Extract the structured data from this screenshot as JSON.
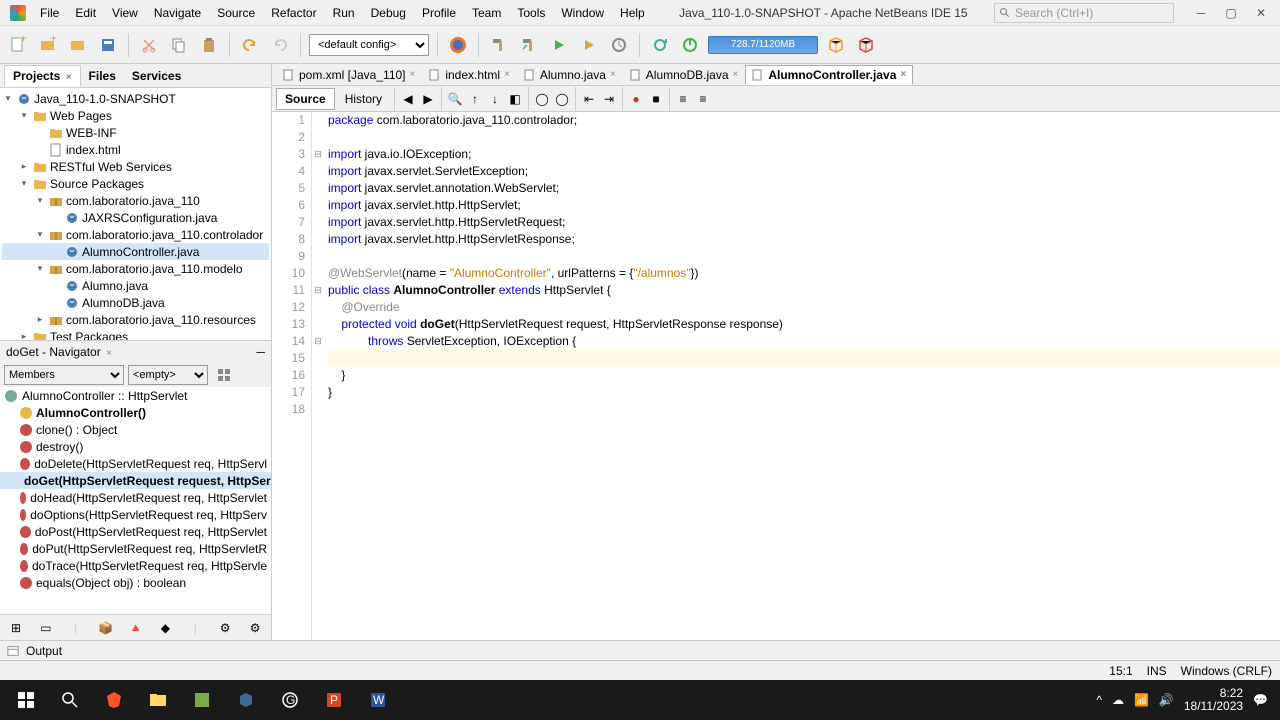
{
  "window_title": "Java_110-1.0-SNAPSHOT - Apache NetBeans IDE 15",
  "search_placeholder": "Search (Ctrl+I)",
  "menu": [
    "File",
    "Edit",
    "View",
    "Navigate",
    "Source",
    "Refactor",
    "Run",
    "Debug",
    "Profile",
    "Team",
    "Tools",
    "Window",
    "Help"
  ],
  "config_select": "<default config>",
  "memory": "728.7/1120MB",
  "left_tabs": [
    "Projects",
    "Files",
    "Services"
  ],
  "project_tree": [
    {
      "indent": 0,
      "toggle": "▾",
      "icon": "java",
      "label": "Java_110-1.0-SNAPSHOT"
    },
    {
      "indent": 1,
      "toggle": "▾",
      "icon": "folder",
      "label": "Web Pages"
    },
    {
      "indent": 2,
      "toggle": "",
      "icon": "folder",
      "label": "WEB-INF"
    },
    {
      "indent": 2,
      "toggle": "",
      "icon": "page",
      "label": "index.html"
    },
    {
      "indent": 1,
      "toggle": "▸",
      "icon": "folder",
      "label": "RESTful Web Services"
    },
    {
      "indent": 1,
      "toggle": "▾",
      "icon": "folder",
      "label": "Source Packages"
    },
    {
      "indent": 2,
      "toggle": "▾",
      "icon": "pkg",
      "label": "com.laboratorio.java_110"
    },
    {
      "indent": 3,
      "toggle": "",
      "icon": "java",
      "label": "JAXRSConfiguration.java"
    },
    {
      "indent": 2,
      "toggle": "▾",
      "icon": "pkg",
      "label": "com.laboratorio.java_110.controlador"
    },
    {
      "indent": 3,
      "toggle": "",
      "icon": "java",
      "label": "AlumnoController.java",
      "selected": true
    },
    {
      "indent": 2,
      "toggle": "▾",
      "icon": "pkg",
      "label": "com.laboratorio.java_110.modelo"
    },
    {
      "indent": 3,
      "toggle": "",
      "icon": "java",
      "label": "Alumno.java"
    },
    {
      "indent": 3,
      "toggle": "",
      "icon": "java",
      "label": "AlumnoDB.java"
    },
    {
      "indent": 2,
      "toggle": "▸",
      "icon": "pkg",
      "label": "com.laboratorio.java_110.resources"
    },
    {
      "indent": 1,
      "toggle": "▸",
      "icon": "folder",
      "label": "Test Packages"
    }
  ],
  "navigator": {
    "title": "doGet - Navigator",
    "filter_label": "Members",
    "empty_label": "<empty>",
    "class_label": "AlumnoController :: HttpServlet",
    "items": [
      {
        "color": "#e8b64a",
        "label": "AlumnoController()",
        "bold": true
      },
      {
        "color": "#c6504f",
        "label": "clone() : Object"
      },
      {
        "color": "#c6504f",
        "label": "destroy()"
      },
      {
        "color": "#c6504f",
        "label": "doDelete(HttpServletRequest req, HttpServl"
      },
      {
        "color": "#c6504f",
        "label": "doGet(HttpServletRequest request, HttpServ",
        "selected": true,
        "bold": true
      },
      {
        "color": "#c6504f",
        "label": "doHead(HttpServletRequest req, HttpServlet"
      },
      {
        "color": "#c6504f",
        "label": "doOptions(HttpServletRequest req, HttpServ"
      },
      {
        "color": "#c6504f",
        "label": "doPost(HttpServletRequest req, HttpServlet"
      },
      {
        "color": "#c6504f",
        "label": "doPut(HttpServletRequest req, HttpServletR"
      },
      {
        "color": "#c6504f",
        "label": "doTrace(HttpServletRequest req, HttpServle"
      },
      {
        "color": "#c6504f",
        "label": "equals(Object obj) : boolean"
      }
    ]
  },
  "editor_tabs": [
    {
      "label": "pom.xml [Java_110]"
    },
    {
      "label": "index.html"
    },
    {
      "label": "Alumno.java"
    },
    {
      "label": "AlumnoDB.java"
    },
    {
      "label": "AlumnoController.java",
      "active": true
    }
  ],
  "editor_subtabs": [
    "Source",
    "History"
  ],
  "code_lines": [
    {
      "n": 1,
      "html": "<span class='kw'>package</span> com.laboratorio.java_110.controlador;"
    },
    {
      "n": 2,
      "html": ""
    },
    {
      "n": 3,
      "html": "<span class='kw'>import</span> java.io.IOException;",
      "fold": "⊟"
    },
    {
      "n": 4,
      "html": "<span class='kw'>import</span> javax.servlet.ServletException;"
    },
    {
      "n": 5,
      "html": "<span class='kw'>import</span> javax.servlet.annotation.WebServlet;"
    },
    {
      "n": 6,
      "html": "<span class='kw'>import</span> javax.servlet.http.HttpServlet;"
    },
    {
      "n": 7,
      "html": "<span class='kw'>import</span> javax.servlet.http.HttpServletRequest;"
    },
    {
      "n": 8,
      "html": "<span class='kw'>import</span> javax.servlet.http.HttpServletResponse;"
    },
    {
      "n": 9,
      "html": ""
    },
    {
      "n": 10,
      "html": "<span class='ann'>@WebServlet</span>(name = <span class='str'>\"AlumnoController\"</span>, urlPatterns = {<span class='str'>\"/alumnos\"</span>})"
    },
    {
      "n": 11,
      "html": "<span class='kw'>public class</span> <span class='cls'>AlumnoController</span> <span class='kw'>extends</span> HttpServlet {",
      "fold": "⊟"
    },
    {
      "n": 12,
      "html": "    <span class='ann'>@Override</span>"
    },
    {
      "n": 13,
      "html": "    <span class='kw'>protected void</span> <span class='cls'>doGet</span>(HttpServletRequest request, HttpServletResponse response)"
    },
    {
      "n": 14,
      "html": "            <span class='kw'>throws</span> ServletException, IOException {",
      "fold": "⊟"
    },
    {
      "n": 15,
      "html": "",
      "highlight": true
    },
    {
      "n": 16,
      "html": "    }"
    },
    {
      "n": 17,
      "html": "}"
    },
    {
      "n": 18,
      "html": ""
    }
  ],
  "output_label": "Output",
  "status": {
    "pos": "15:1",
    "ins": "INS",
    "enc": "Windows (CRLF)"
  },
  "tray": {
    "time": "8:22",
    "date": "18/11/2023"
  }
}
